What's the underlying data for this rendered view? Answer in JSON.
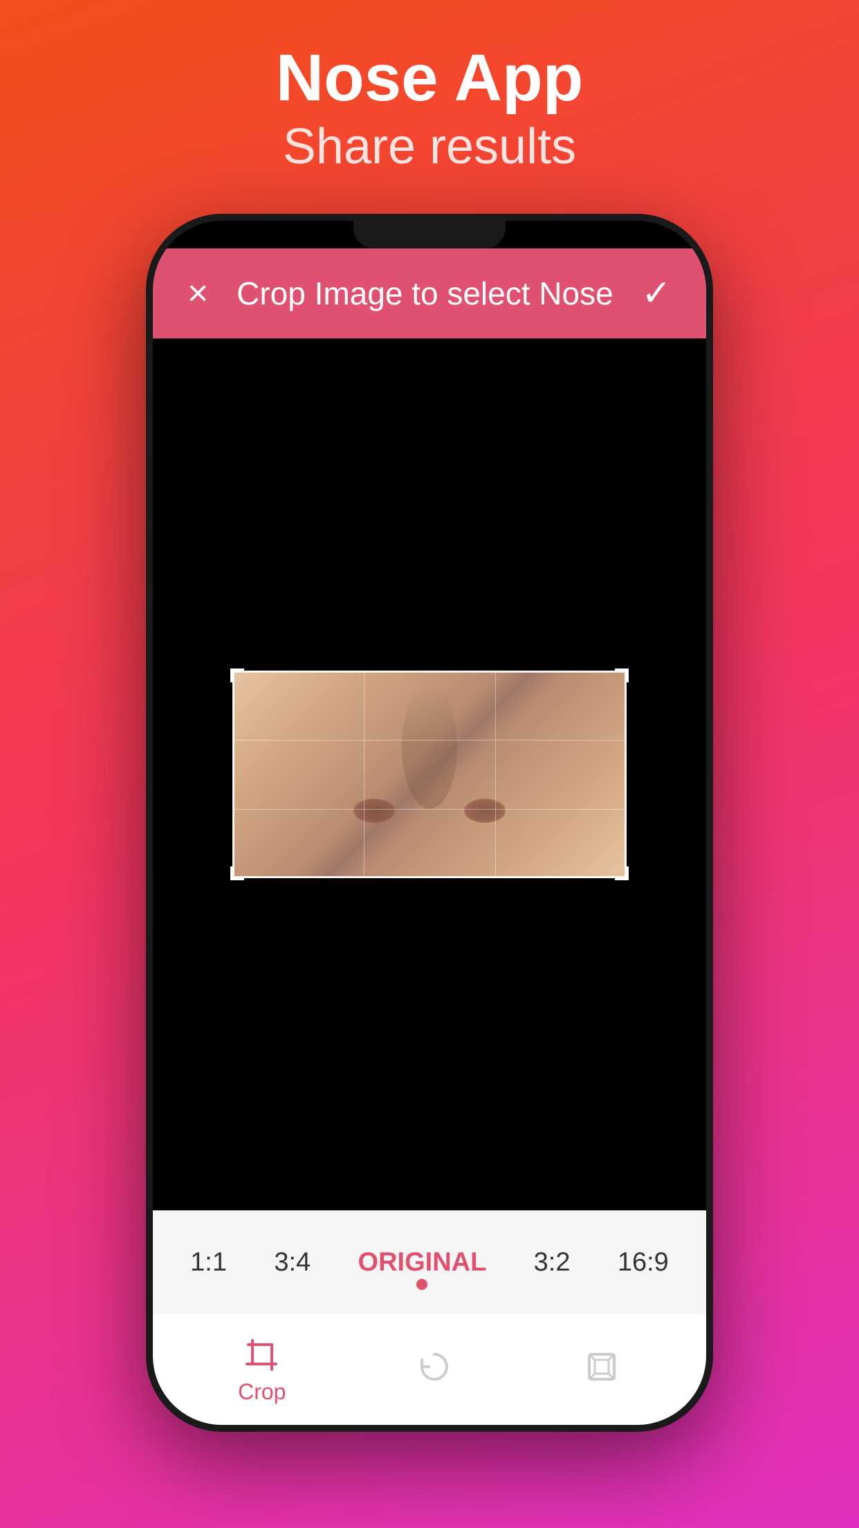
{
  "header": {
    "title": "Nose App",
    "subtitle": "Share results"
  },
  "cropBar": {
    "title": "Crop Image to select Nose",
    "cancelLabel": "×",
    "confirmLabel": "✓"
  },
  "ratioBar": {
    "options": [
      {
        "label": "1:1",
        "active": false
      },
      {
        "label": "3:4",
        "active": false
      },
      {
        "label": "ORIGINAL",
        "active": true
      },
      {
        "label": "3:2",
        "active": false
      },
      {
        "label": "16:9",
        "active": false
      }
    ]
  },
  "toolbar": {
    "items": [
      {
        "label": "Crop",
        "active": true,
        "icon": "crop-icon"
      },
      {
        "label": "",
        "active": false,
        "icon": "rotate-icon"
      },
      {
        "label": "",
        "active": false,
        "icon": "expand-icon"
      }
    ]
  },
  "colors": {
    "accent": "#e05070",
    "background_gradient_start": "#f44e1a",
    "background_gradient_end": "#e030c0",
    "phone_body": "#1a1a1a",
    "screen_bg": "#000000"
  }
}
